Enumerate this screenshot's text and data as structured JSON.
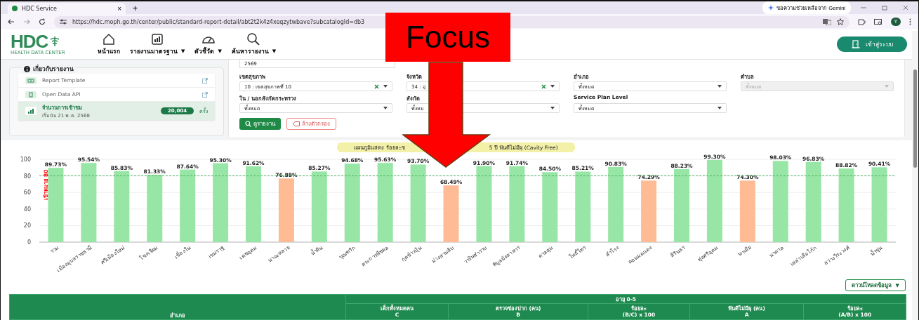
{
  "browser": {
    "tab_title": "HDC Service",
    "tab_close": "×",
    "new_tab": "+",
    "url": "https://hdc.moph.go.th/center/public/standard-report-detail/abt2t2k4z4xeqzytwbave?subcatalogId=db3",
    "gemini": "ขอความช่วยเหลือจาก Gemini",
    "profile": "Y"
  },
  "header": {
    "logo": "HDC",
    "logo_sub": "HEALTH DATA CENTER",
    "nav": [
      {
        "label": "หน้าแรก"
      },
      {
        "label": "รายงานมาตรฐาน",
        "caret": "▼"
      },
      {
        "label": "ตัวชี้วัด",
        "caret": "▼"
      },
      {
        "label": "ค้นหารายงาน",
        "caret": "▼"
      }
    ],
    "login": "เข้าสู่ระบบ"
  },
  "about": {
    "title": "เกี่ยวกับรายงาน",
    "links": [
      {
        "label": "Report Template"
      },
      {
        "label": "Open Data API"
      }
    ],
    "visits": {
      "label": "จำนวนการเข้าชม",
      "since": "เริ่มนับ 21 พ.ค. 2568",
      "count": "20,004",
      "unit": "ครั้ง"
    }
  },
  "filters": {
    "year": "2569",
    "fields": [
      {
        "label": "เขตสุขภาพ",
        "value": "10 : เขตสุขภาพที่ 10",
        "clearable": true,
        "disabled": false
      },
      {
        "label": "จังหวัด",
        "value": "34 : อุ",
        "clearable": true,
        "disabled": false
      },
      {
        "label": "อำเภอ",
        "value": "ทั้งหมด",
        "clearable": false,
        "disabled": false
      },
      {
        "label": "ตำบล",
        "value": "ทั้งหมด",
        "clearable": false,
        "disabled": true
      },
      {
        "label": "ใน / นอกสังกัดกระทรวง",
        "value": "ทั้งหมด",
        "clearable": false,
        "disabled": false
      },
      {
        "label": "สังกัด",
        "value": "ทั้งหม",
        "clearable": false,
        "disabled": false
      },
      {
        "label": "Service Plan Level",
        "value": "ทั้งหมด",
        "clearable": false,
        "disabled": false
      }
    ],
    "search_button": "ดูรายงาน",
    "clear_button": "ล้างตัวกรอง"
  },
  "chart": {
    "title_parts": [
      "แผนภูมิแสดง ร้อยละข",
      "5 ปี ฟันดีไม่มีผุ (Cavity Free)"
    ],
    "chart_data": {
      "type": "bar",
      "stacked": true,
      "grid": true,
      "ylim": [
        0,
        100
      ],
      "yticks": [
        0,
        20,
        40,
        60,
        80,
        100
      ],
      "categories": [
        "รวม",
        "เมืองอุบลราชธานี",
        "ศรีเมืองใหม่",
        "โขงเจียม",
        "เขื่องใน",
        "เขมราฐ",
        "เดชอุดม",
        "นาจะหลวย",
        "น้ำยืน",
        "บุณฑริก",
        "ตระการพืชผล",
        "กุดข้าวปุ้น",
        "ม่วงสามสิบ",
        "วารินชำราบ",
        "พิบูลมังสาหาร",
        "ตาลสุม",
        "โพธิ์ไทร",
        "สำโรง",
        "ดอนมดแดง",
        "สิรินธร",
        "ทุ่งศรีอุดม",
        "นาเยีย",
        "นาตาล",
        "เหล่าเสือโก้ก",
        "สว่างวีระวงศ์",
        "น้ำขุ่น"
      ],
      "series": [
        {
          "color": "#98e6a6",
          "values": [
            89.73,
            95.54,
            85.83,
            81.33,
            87.64,
            95.3,
            91.62,
            null,
            85.27,
            94.68,
            95.63,
            93.7,
            null,
            91.9,
            91.74,
            84.5,
            85.21,
            90.83,
            null,
            88.23,
            99.3,
            null,
            98.03,
            96.83,
            88.82,
            90.41
          ]
        },
        {
          "color": "#ffbb94",
          "values": [
            null,
            null,
            null,
            null,
            null,
            null,
            null,
            76.88,
            null,
            null,
            null,
            null,
            68.49,
            null,
            null,
            null,
            null,
            null,
            74.29,
            null,
            null,
            74.3,
            null,
            null,
            null,
            null
          ]
        }
      ],
      "value_labels": [
        "89.73%",
        "95.54%",
        "85.83%",
        "81.33%",
        "87.64%",
        "95.30%",
        "91.62%",
        "76.88%",
        "85.27%",
        "94.68%",
        "95.63%",
        "93.70%",
        "68.49%",
        "91.90%",
        "91.74%",
        "84.50%",
        "85.21%",
        "90.83%",
        "74.29%",
        "88.23%",
        "99.30%",
        "74.30%",
        "98.03%",
        "96.83%",
        "88.82%",
        "90.41%"
      ],
      "ref_lines": [
        {
          "axis": "y",
          "value": 80,
          "label": "เป้าหมาย 80"
        }
      ]
    }
  },
  "download_button": "ดาวน์โหลดข้อมูล",
  "download_caret": "▼",
  "table": {
    "first_column": "อำเภอ",
    "group": "อายุ 0-5",
    "columns": [
      {
        "label": "เด็กทั้งหมดคน",
        "formula": "C"
      },
      {
        "label": "ตรวจช่องปาก (คน)",
        "formula": "B"
      },
      {
        "label": "ร้อยละ",
        "formula": "(B/C) x 100"
      },
      {
        "label": "ฟันดีไม่มีผุ (คน)",
        "formula": "A"
      },
      {
        "label": "ร้อยละ",
        "formula": "(A/B) x 100"
      }
    ]
  },
  "overlay": {
    "label": "Focus"
  }
}
